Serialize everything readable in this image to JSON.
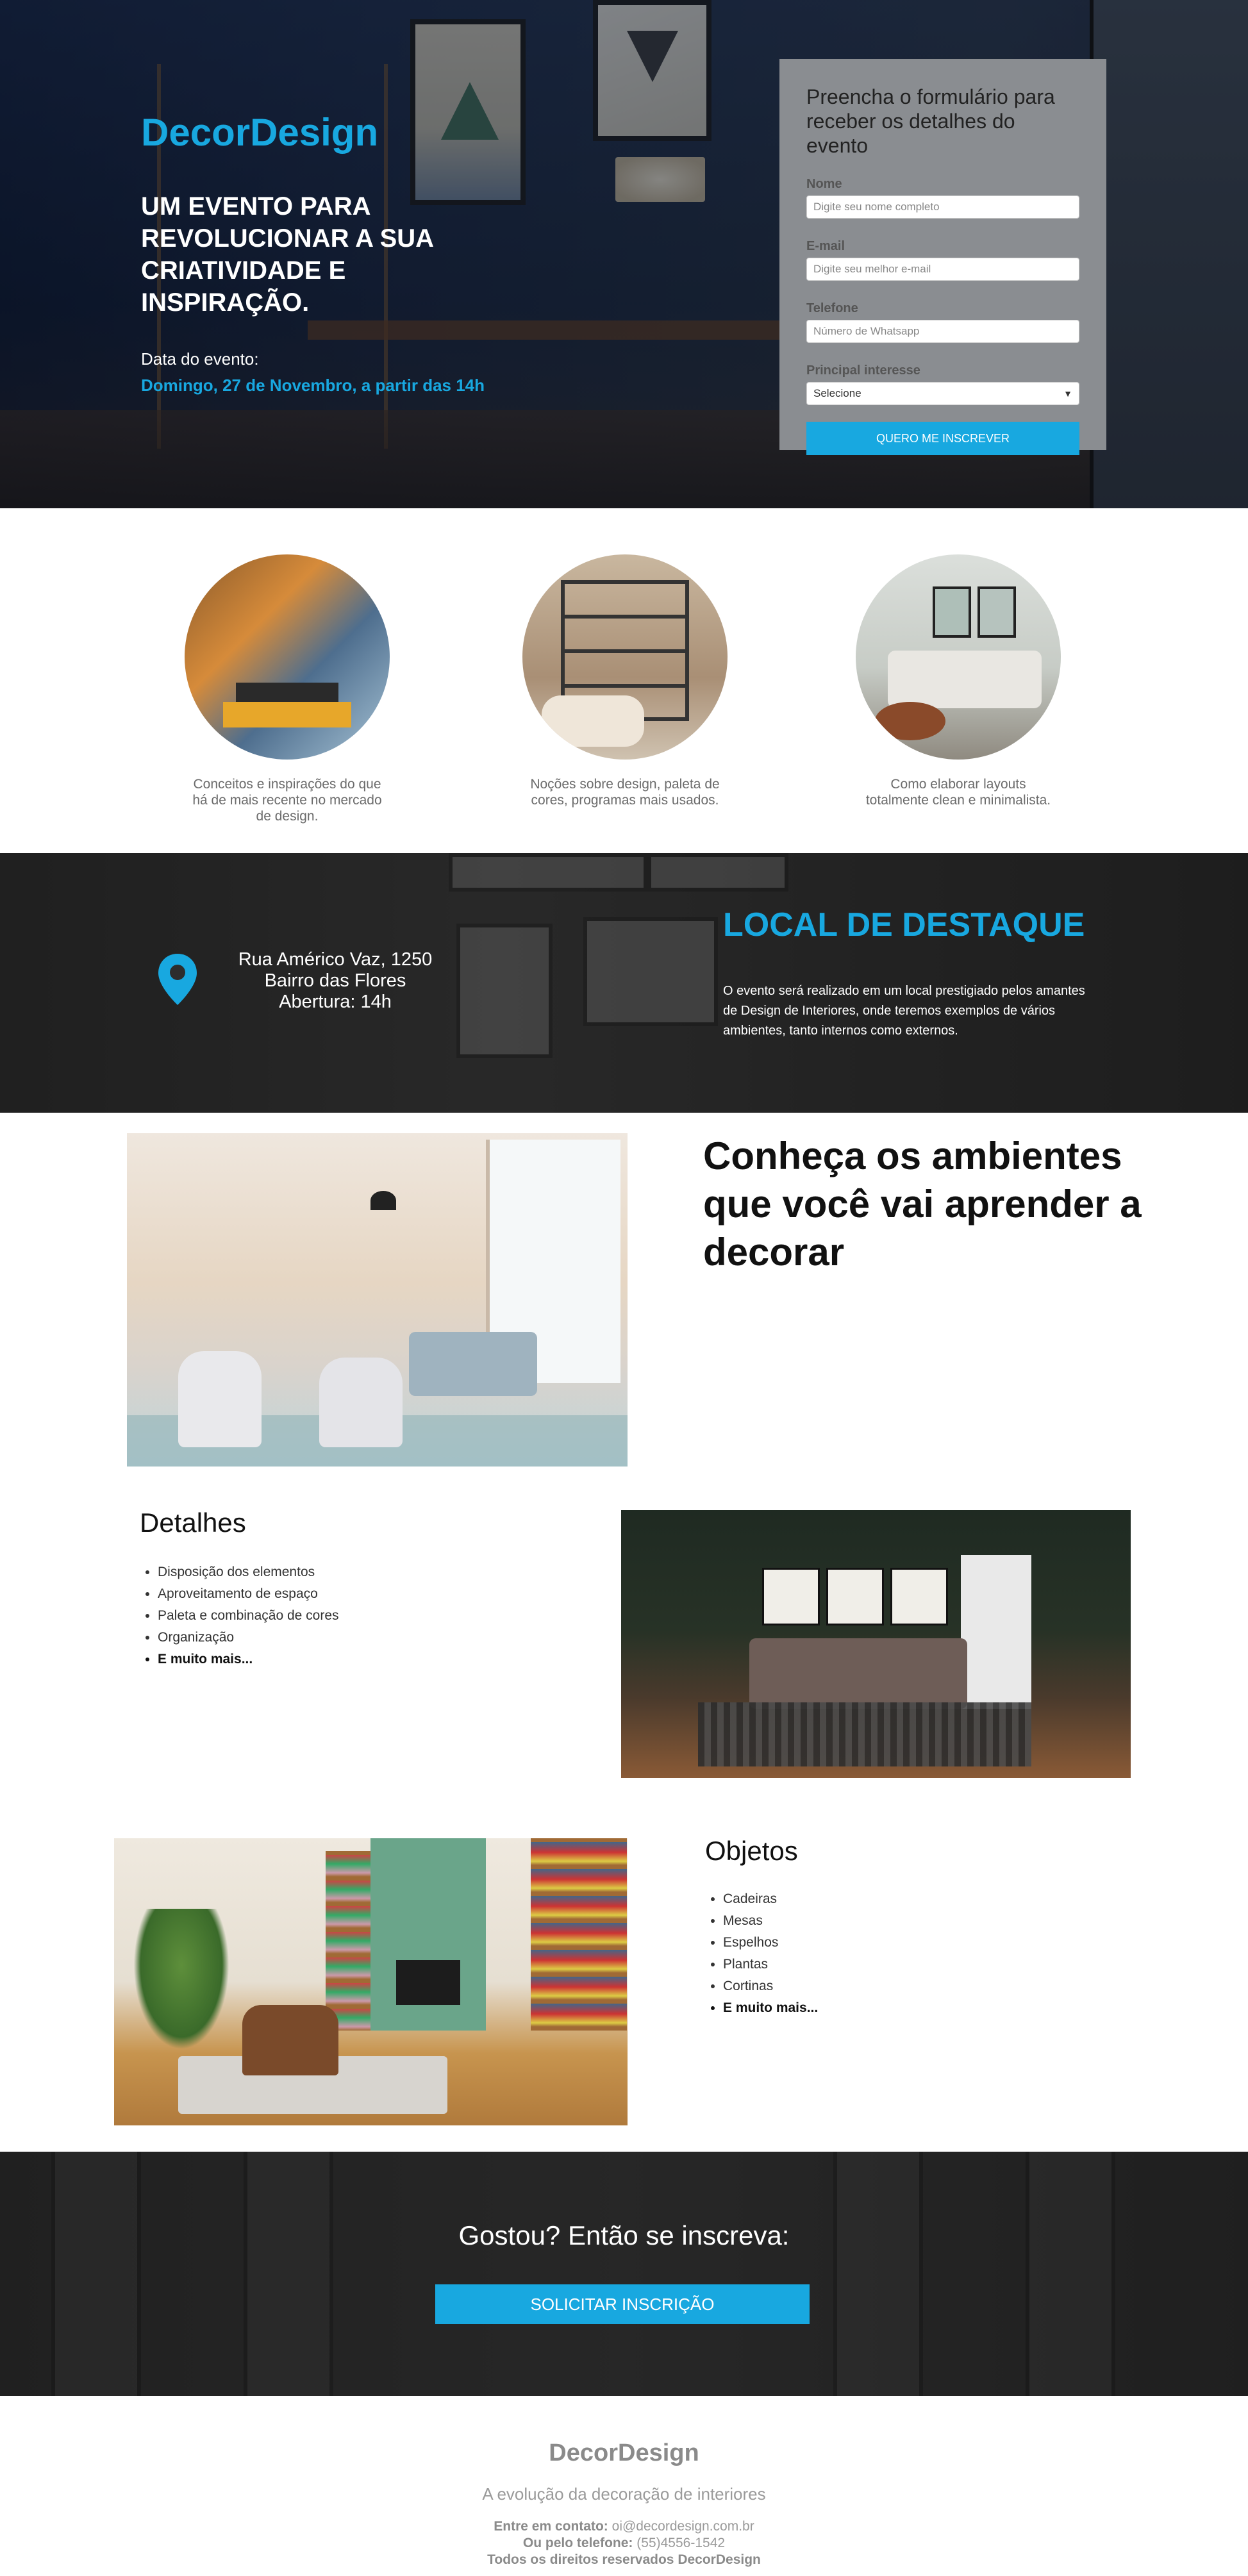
{
  "hero": {
    "brand": "DecorDesign",
    "title": "UM EVENTO PARA REVOLUCIONAR A SUA CRIATIVIDADE E INSPIRAÇÃO.",
    "event_label": "Data do evento:",
    "event_date": "Domingo, 27 de Novembro, a partir das 14h"
  },
  "form": {
    "title": "Preencha o formulário para receber os detalhes do evento",
    "fields": [
      {
        "label": "Nome",
        "placeholder": "Digite seu nome completo"
      },
      {
        "label": "E-mail",
        "placeholder": "Digite seu melhor e-mail"
      },
      {
        "label": "Telefone",
        "placeholder": "Número de Whatsapp"
      },
      {
        "label": "Principal interesse",
        "value": "Selecione"
      }
    ],
    "submit": "QUERO ME INSCREVER"
  },
  "features": [
    {
      "text": "Conceitos e inspirações do que há de mais recente no mercado de design."
    },
    {
      "text": "Noções sobre design, paleta de cores, programas mais usados."
    },
    {
      "text": "Como elaborar layouts totalmente clean e minimalista."
    }
  ],
  "local": {
    "address": [
      "Rua Américo Vaz, 1250",
      "Bairro das Flores",
      "Abertura: 14h"
    ],
    "title": "LOCAL DE DESTAQUE",
    "text": "O evento será realizado em um local prestigiado pelos amantes de Design de Interiores, onde teremos exemplos de vários ambientes, tanto internos como externos.",
    "pin_icon": "map-pin-icon"
  },
  "ambientes": {
    "title": "Conheça os ambientes que você vai aprender a decorar",
    "details_title": "Detalhes",
    "details": [
      "Disposição dos elementos",
      "Aproveitamento de espaço",
      "Paleta e combinação de cores",
      "Organização",
      "E muito mais..."
    ],
    "objects_title": "Objetos",
    "objects": [
      "Cadeiras",
      "Mesas",
      "Espelhos",
      "Plantas",
      "Cortinas",
      "E muito mais..."
    ]
  },
  "cta": {
    "title": "Gostou? Então se inscreva:",
    "button": "SOLICITAR INSCRIÇÃO"
  },
  "footer": {
    "brand": "DecorDesign",
    "tagline": "A evolução da decoração de interiores",
    "contact_label": "Entre em contato:",
    "contact_email": "oi@decordesign.com.br",
    "phone_label": "Ou pelo telefone:",
    "phone": "(55)4556-1542",
    "rights": "Todos os direitos reservados DecorDesign"
  },
  "colors": {
    "accent": "#18a8e0",
    "form_bg": "#8a8d91"
  }
}
